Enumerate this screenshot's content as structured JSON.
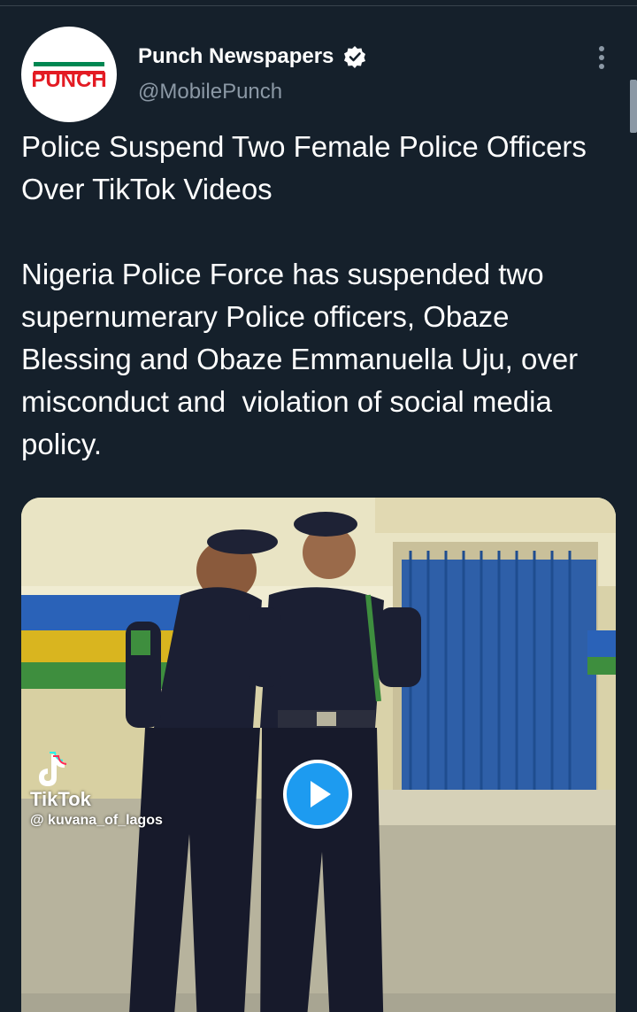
{
  "tweet": {
    "author": {
      "name": "Punch Newspapers",
      "handle": "@MobilePunch",
      "avatar_text": "PUNCH",
      "verified": true
    },
    "text": "Police Suspend Two Female Police Officers Over TikTok Videos\n\nNigeria Police Force has suspended two supernumerary Police officers, Obaze Blessing and Obaze Emmanuella Uju, over misconduct and  violation of social media policy.",
    "media": {
      "type": "video",
      "watermark_brand": "TikTok",
      "watermark_user": "@ kuvana_of_lagos"
    }
  },
  "colors": {
    "background": "#15202b",
    "text_primary": "#ffffff",
    "text_secondary": "#8b98a5",
    "accent": "#1d9bf0"
  },
  "icons": {
    "verified": "verified-badge-icon",
    "more": "more-options-icon",
    "play": "play-icon",
    "tiktok": "tiktok-logo-icon"
  }
}
